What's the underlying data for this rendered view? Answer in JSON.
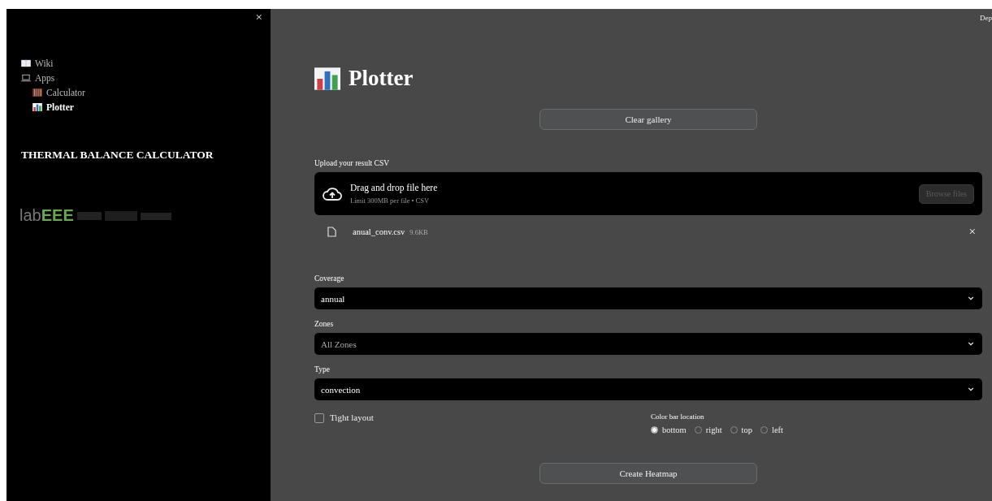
{
  "sidebar": {
    "close": "×",
    "items": [
      {
        "label": "Wiki",
        "kind": "book",
        "selected": false
      },
      {
        "label": "Apps",
        "kind": "laptop",
        "selected": false,
        "children": [
          {
            "label": "Calculator",
            "kind": "abacus",
            "selected": false
          },
          {
            "label": "Plotter",
            "kind": "chart",
            "selected": true
          }
        ]
      }
    ],
    "heading": "THERMAL BALANCE CALCULATOR",
    "logo": {
      "light": "lab",
      "bold": "EEE"
    }
  },
  "toolbar": {
    "deploy": "Dep"
  },
  "page": {
    "title": "Plotter",
    "clear_button": "Clear gallery",
    "upload": {
      "label": "Upload your result CSV",
      "drop_text": "Drag and drop file here",
      "limit": "Limit 300MB per file • CSV",
      "browse": "Browse files",
      "browse_disabled": true,
      "file": {
        "name": "anual_conv.csv",
        "size": "9.6KB",
        "remove": "×"
      }
    },
    "selects": [
      {
        "label": "Coverage",
        "value": "annual"
      },
      {
        "label": "Zones",
        "placeholder": "All Zones"
      },
      {
        "label": "Type",
        "value": "convection"
      }
    ],
    "checkbox": {
      "label": "Tight layout",
      "checked": false
    },
    "radio_group": {
      "label": "Color bar location",
      "options": [
        {
          "label": "bottom",
          "selected": true
        },
        {
          "label": "right",
          "selected": false
        },
        {
          "label": "top",
          "selected": false
        },
        {
          "label": "left",
          "selected": false
        }
      ]
    },
    "create_button": "Create Heatmap"
  }
}
